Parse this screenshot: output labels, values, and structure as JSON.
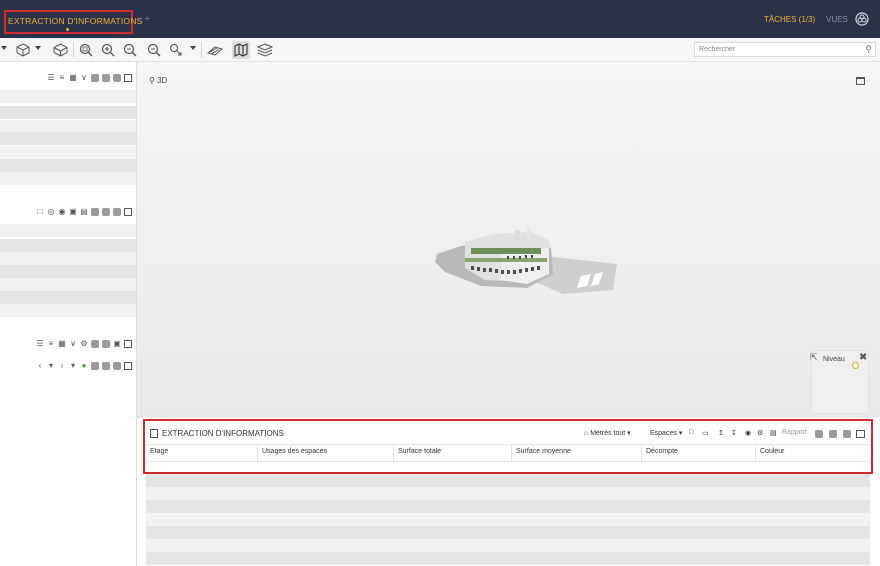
{
  "topbar": {
    "active_tab": "EXTRACTION D'INFORMATIONS",
    "add_tab": "+",
    "tasks": "TÂCHES (1/3)",
    "views": "VUES"
  },
  "toolbar": {
    "search_placeholder": "Rechercher"
  },
  "viewport": {
    "mode_label": "3D",
    "niveau_label": "Niveau"
  },
  "extraction_panel": {
    "title": "EXTRACTION D'INFORMATIONS",
    "metres_label": "Métrés tout",
    "espaces_label": "Espaces",
    "rapport_label": "Rapport",
    "columns": [
      "Etage",
      "Usages des espaces",
      "Surface totale",
      "Surface moyenne",
      "Décompte",
      "Couleur"
    ]
  },
  "colors": {
    "topbar_bg": "#2b3147",
    "accent": "#f0b23a",
    "highlight": "#d12b2b"
  }
}
